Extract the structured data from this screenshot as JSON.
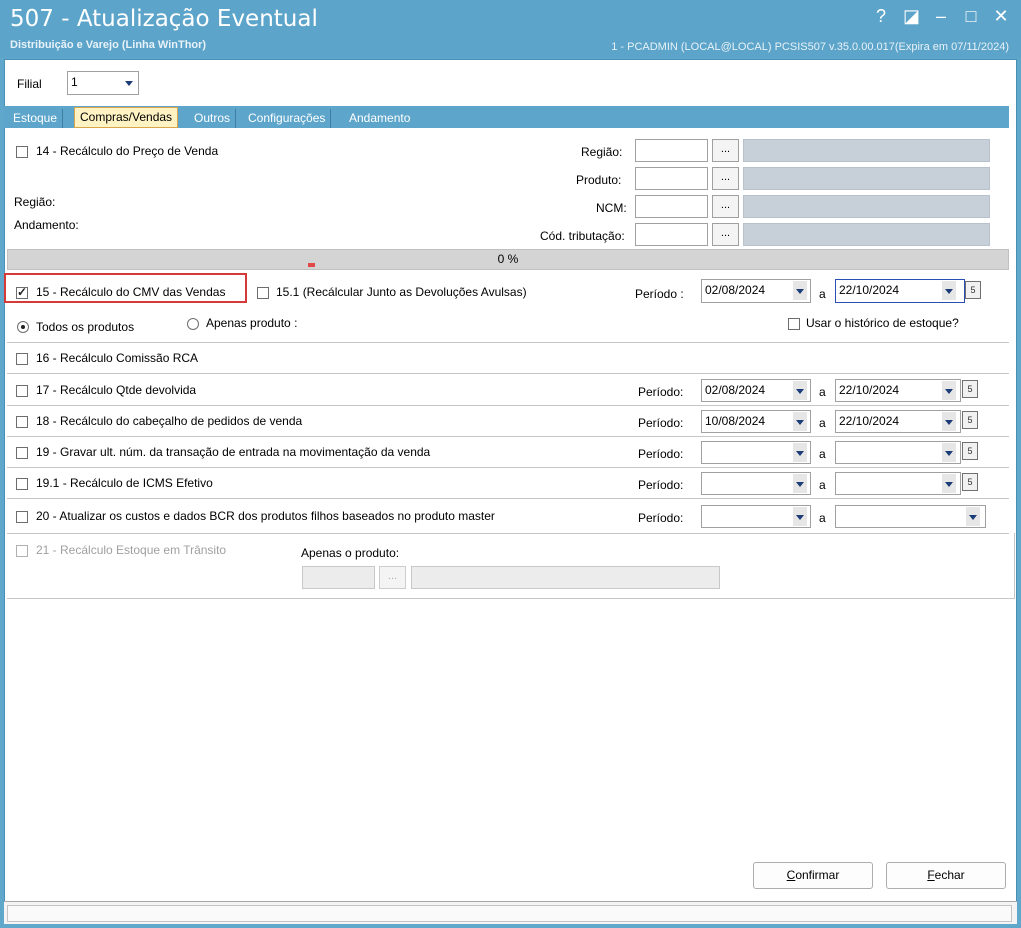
{
  "titlebar": {
    "title": "507 - Atualização Eventual",
    "subtitle": "Distribuição e Varejo (Linha WinThor)",
    "info": "1 - PCADMIN (LOCAL@LOCAL)   PCSIS507  v.35.0.00.017(Expira em 07/11/2024)",
    "help": "?",
    "restore": "◪",
    "minimize": "–",
    "maximize": "□",
    "close": "✕"
  },
  "filial": {
    "label": "Filial",
    "value": "1"
  },
  "tabs": [
    {
      "label": "Estoque"
    },
    {
      "label": "Compras/Vendas"
    },
    {
      "label": "Outros"
    },
    {
      "label": "Configurações"
    },
    {
      "label": "Andamento"
    }
  ],
  "section14": {
    "label": "14 - Recálculo do Preço de Venda",
    "regiao_left": "Região:",
    "andamento_left": "Andamento:",
    "regiao": "Região:",
    "produto": "Produto:",
    "ncm": "NCM:",
    "cod_tributacao": "Cód. tributação:",
    "dots": "..."
  },
  "progress": {
    "text": "0 %"
  },
  "section15": {
    "label": "15 - Recálculo do CMV das Vendas",
    "label_151": "15.1 (Recálcular Junto as Devoluções Avulsas)",
    "periodo": "Período :",
    "date_from": "02/08/2024",
    "a": "a",
    "date_to": "22/10/2024",
    "radio_todos": "Todos os produtos",
    "radio_apenas": "Apenas produto :",
    "usar_historico": "Usar o histórico de estoque?"
  },
  "section16": {
    "label": "16 - Recálculo Comissão RCA"
  },
  "section17": {
    "label": "17 - Recálculo Qtde devolvida",
    "periodo": "Período:",
    "date_from": "02/08/2024",
    "a": "a",
    "date_to": "22/10/2024"
  },
  "section18": {
    "label": "18 - Recálculo do cabeçalho de pedidos de venda",
    "periodo": "Período:",
    "date_from": "10/08/2024",
    "a": "a",
    "date_to": "22/10/2024"
  },
  "section19": {
    "label": "19 - Gravar ult. núm. da transação de entrada na movimentação da venda",
    "periodo": "Período:",
    "a": "a"
  },
  "section191": {
    "label": "19.1 - Recálculo de ICMS Efetivo",
    "periodo": "Período:",
    "a": "a"
  },
  "section20": {
    "label": "20 - Atualizar os custos e dados BCR dos produtos filhos baseados no produto master",
    "periodo": "Período:",
    "a": "a"
  },
  "section21": {
    "label": "21 - Recálculo Estoque em Trânsito",
    "apenas": "Apenas o produto:",
    "dots": "..."
  },
  "buttons": {
    "confirmar_hotkey": "C",
    "confirmar_rest": "onfirmar",
    "fechar_hotkey": "F",
    "fechar_rest": "echar"
  },
  "cal_glyph": "5"
}
